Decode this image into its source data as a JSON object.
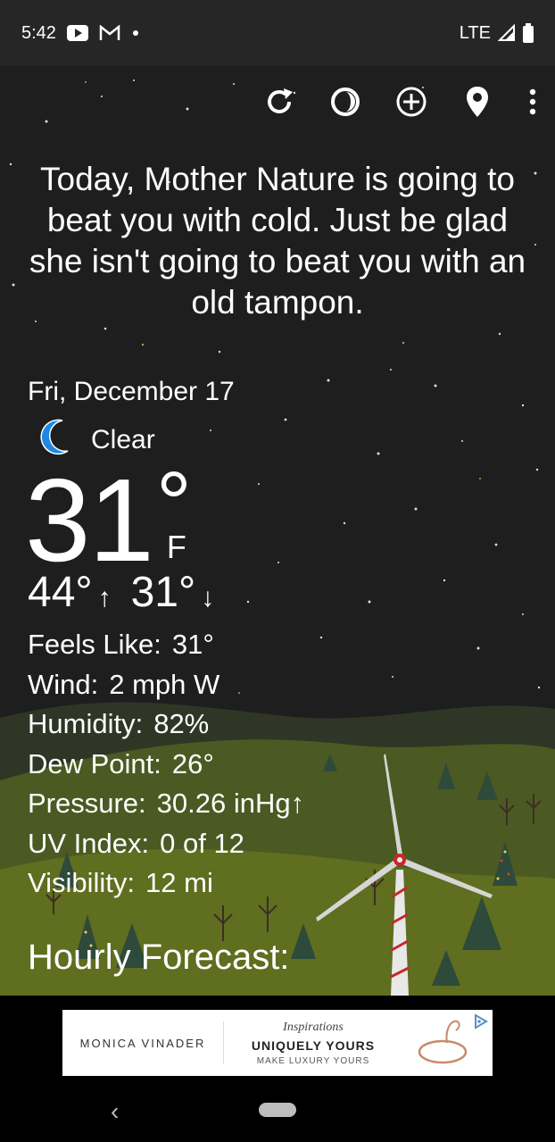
{
  "status_bar": {
    "time": "5:42",
    "network": "LTE",
    "notification_icons": [
      "youtube-icon",
      "gmail-icon",
      "dot-icon"
    ]
  },
  "toolbar": {
    "icons": [
      "refresh-icon",
      "theme-icon",
      "add-location-icon",
      "location-pin-icon",
      "more-icon"
    ]
  },
  "quote": "Today, Mother Nature is going to beat you with cold. Just be glad she isn't going to beat you with an old tampon.",
  "weather": {
    "date": "Fri, December 17",
    "condition": "Clear",
    "condition_icon": "moon-icon",
    "temperature": "31",
    "degree": "°",
    "unit": "F",
    "high": "44°",
    "low": "31°",
    "up_arrow": "↑",
    "down_arrow": "↓"
  },
  "details": [
    {
      "label": "Feels Like:",
      "value": "31°"
    },
    {
      "label": "Wind:",
      "value": "2 mph W"
    },
    {
      "label": "Humidity:",
      "value": "82%"
    },
    {
      "label": "Dew Point:",
      "value": "26°"
    },
    {
      "label": "Pressure:",
      "value": "30.26 inHg↑"
    },
    {
      "label": "UV Index:",
      "value": "0 of 12"
    },
    {
      "label": "Visibility:",
      "value": "12 mi"
    }
  ],
  "hourly_title": "Hourly Forecast:",
  "ad": {
    "brand": "MONICA VINADER",
    "tagline": "Inspirations",
    "headline": "UNIQUELY YOURS",
    "subline": "MAKE LUXURY YOURS"
  },
  "nav": {
    "back_glyph": "‹"
  },
  "colors": {
    "sky": "#1e1e1e",
    "moon": "#1e88e5",
    "hill": "#4a5a22",
    "status_bar": "#262626"
  }
}
